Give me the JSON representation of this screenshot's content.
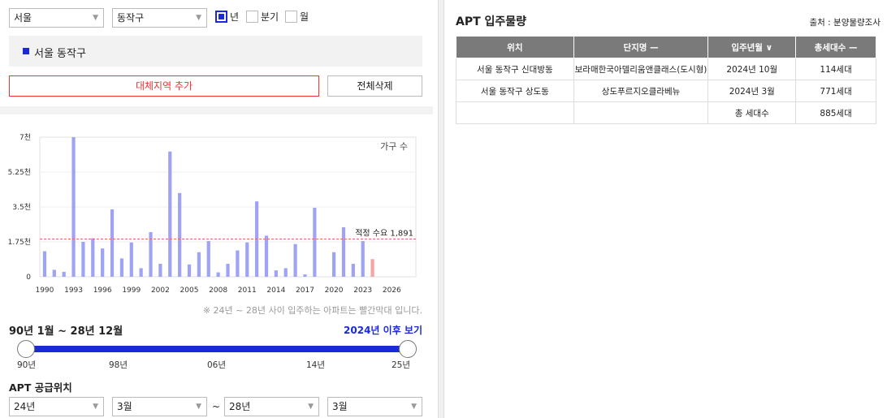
{
  "filters": {
    "city": "서울",
    "district": "동작구",
    "unit_year": "년",
    "unit_quarter": "분기",
    "unit_month": "월"
  },
  "region_label": "서울 동작구",
  "buttons": {
    "add": "대체지역 추가",
    "delete_all": "전체삭제"
  },
  "chart_data": {
    "type": "bar",
    "yticks": [
      "0",
      "1.75천",
      "3.5천",
      "5.25천",
      "7천"
    ],
    "ylim": [
      0,
      7000
    ],
    "xticks": [
      "1990",
      "1993",
      "1996",
      "1999",
      "2002",
      "2005",
      "2008",
      "2011",
      "2014",
      "2017",
      "2020",
      "2023",
      "2026"
    ],
    "legend": "가구 수",
    "reference_label": "적정 수요 1,891",
    "reference_value": 1891,
    "grid": true,
    "series": [
      {
        "values": [
          {
            "x": 1990,
            "y": 1280
          },
          {
            "x": 1991,
            "y": 350
          },
          {
            "x": 1992,
            "y": 250
          },
          {
            "x": 1993,
            "y": 7000
          },
          {
            "x": 1994,
            "y": 1750
          },
          {
            "x": 1995,
            "y": 1930
          },
          {
            "x": 1996,
            "y": 1420
          },
          {
            "x": 1997,
            "y": 3380
          },
          {
            "x": 1998,
            "y": 920
          },
          {
            "x": 1999,
            "y": 1720
          },
          {
            "x": 2000,
            "y": 430
          },
          {
            "x": 2001,
            "y": 2240
          },
          {
            "x": 2002,
            "y": 650
          },
          {
            "x": 2003,
            "y": 6280
          },
          {
            "x": 2004,
            "y": 4200
          },
          {
            "x": 2005,
            "y": 620
          },
          {
            "x": 2006,
            "y": 1230
          },
          {
            "x": 2007,
            "y": 1790
          },
          {
            "x": 2008,
            "y": 220
          },
          {
            "x": 2009,
            "y": 650
          },
          {
            "x": 2010,
            "y": 1320
          },
          {
            "x": 2011,
            "y": 1720
          },
          {
            "x": 2012,
            "y": 3780
          },
          {
            "x": 2013,
            "y": 2060
          },
          {
            "x": 2014,
            "y": 320
          },
          {
            "x": 2015,
            "y": 430
          },
          {
            "x": 2016,
            "y": 1640
          },
          {
            "x": 2017,
            "y": 120
          },
          {
            "x": 2018,
            "y": 3460
          },
          {
            "x": 2020,
            "y": 1230
          },
          {
            "x": 2021,
            "y": 2480
          },
          {
            "x": 2022,
            "y": 650
          },
          {
            "x": 2023,
            "y": 1790
          },
          {
            "x": 2024,
            "y": 885,
            "highlight": true
          }
        ]
      }
    ]
  },
  "chart_note": "※ 24년 ~ 28년 사이 입주하는 아파트는 빨간막대 입니다.",
  "period": {
    "label": "90년 1월 ~ 28년 12월",
    "after_link": "2024년 이후 보기",
    "ticks": [
      "90년",
      "98년",
      "06년",
      "14년",
      "25년"
    ],
    "range_start_fraction": 0.0,
    "range_end_fraction": 1.0
  },
  "supply": {
    "title": "APT 공급위치",
    "from_year": "24년",
    "from_month": "3월",
    "tilde": "~",
    "to_year": "28년",
    "to_month": "3월"
  },
  "right": {
    "title": "APT 입주물량",
    "source": "출처 : 분양물량조사",
    "headers": [
      "위치",
      "단지명 —",
      "입주년월 ∨",
      "총세대수 —"
    ],
    "rows": [
      [
        "서울 동작구 신대방동",
        "보라매한국아델리움앤클래스(도시형)",
        "2024년 10월",
        "114세대"
      ],
      [
        "서울 동작구 상도동",
        "상도푸르지오클라베뉴",
        "2024년 3월",
        "771세대"
      ],
      [
        "",
        "",
        "총 세대수",
        "885세대"
      ]
    ]
  },
  "colors": {
    "accent": "#1a2bd6",
    "bar": "#9ea3f3",
    "bar_highlight": "#f5a3a3",
    "reference": "#e66",
    "danger": "#e33"
  }
}
